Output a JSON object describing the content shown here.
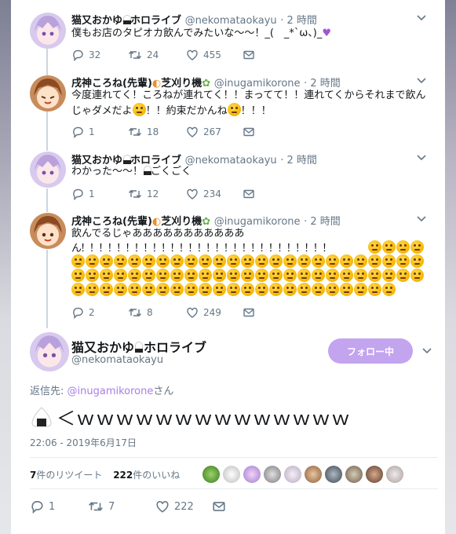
{
  "tweets": [
    {
      "name": "猫又おかゆ",
      "badge": "ホロライブ",
      "handle": "@nekomataokayu",
      "time": "· 2 時間",
      "text": "僕もお店のタピオカ飲んでみたいな～～！_(　_*`ω、)_",
      "replies": "32",
      "retweets": "24",
      "likes": "455"
    },
    {
      "name": "戌神ころね(先輩)",
      "badge": "芝刈り機",
      "handle": "@inugamikorone",
      "time": "· 2 時間",
      "text_line1": "今度連れてく！ころねが連れてく！！まってて！！連れてくからそれまで飲ん",
      "text_line2": "じゃダメだよ",
      "text_line2b": "！！約束だかんね",
      "text_line2c": "！！！",
      "replies": "1",
      "retweets": "18",
      "likes": "267"
    },
    {
      "name": "猫又おかゆ",
      "badge": "ホロライブ",
      "handle": "@nekomataokayu",
      "time": "· 2 時間",
      "text": "わかった～～！",
      "text_after": "ごくごく",
      "replies": "1",
      "retweets": "12",
      "likes": "234"
    },
    {
      "name": "戌神ころね(先輩)",
      "badge": "芝刈り機",
      "handle": "@inugamikorone",
      "time": "· 2 時間",
      "text_line1": "飲んでるじゃあああああああああああ",
      "text_line2": "ん！！！！！！！！！！！！！！！！！！！！！！！！！！！！",
      "replies": "2",
      "retweets": "8",
      "likes": "249"
    }
  ],
  "main": {
    "name": "猫又おかゆ",
    "badge": "ホロライブ",
    "handle": "@nekomataokayu",
    "follow_label": "フォロー中",
    "reply_to_prefix": "返信先: ",
    "reply_to_handle": "@inugamikorone",
    "reply_to_suffix": "さん",
    "text": "＜ｗｗｗｗｗｗｗｗｗｗｗｗｗｗ",
    "timestamp": "22:06 - 2019年6月17日",
    "retweet_count": "7",
    "retweet_label": "件のリツイート",
    "like_count": "222",
    "like_label": "件のいいね",
    "replies": "1",
    "retweets": "7",
    "likes": "222"
  },
  "colors": {
    "accent": "#c3a4ef",
    "link": "#a77fe6",
    "meta": "#657786",
    "emoji": "#f7b500"
  }
}
